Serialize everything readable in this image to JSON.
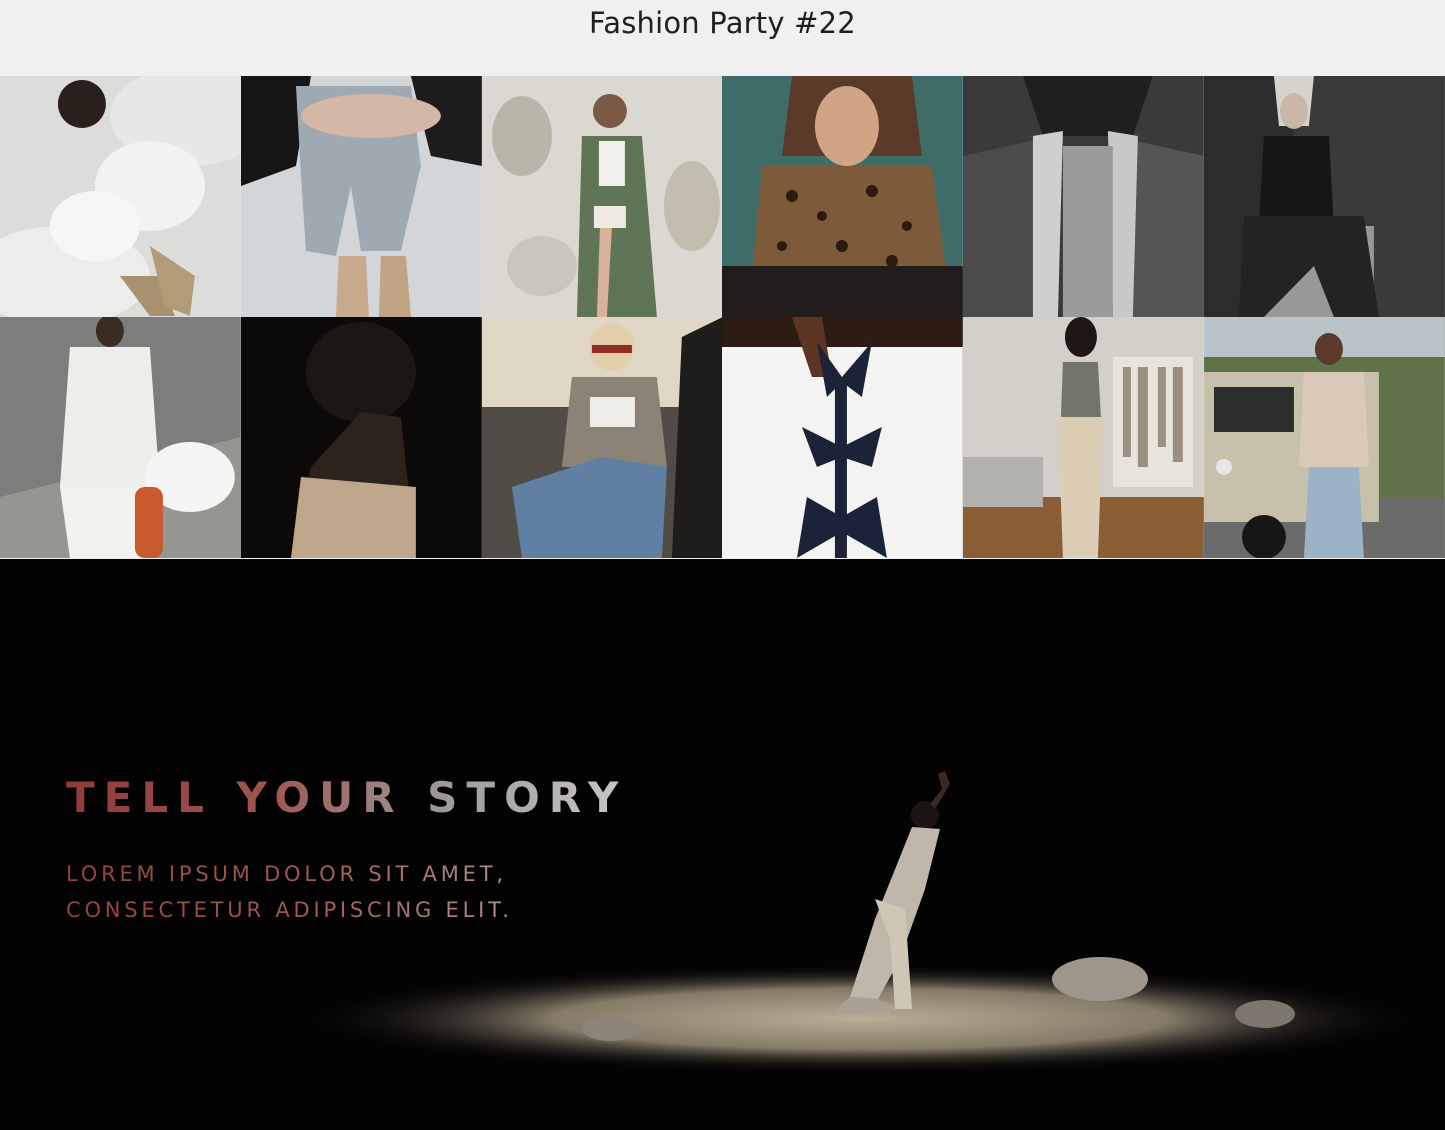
{
  "header": {
    "title": "Fashion Party #22"
  },
  "gallery": {
    "photos": [
      {
        "name": "photo-angel-wings-clouds",
        "bg": "#d9d9d7"
      },
      {
        "name": "photo-jeans-snakeskin-boots",
        "bg": "#cfd3d5"
      },
      {
        "name": "photo-green-cardigan-wall",
        "bg": "#d8d6cf"
      },
      {
        "name": "photo-leopard-coat",
        "bg": "#3f6e6a"
      },
      {
        "name": "photo-shearling-jacket",
        "bg": "#4a4a4a"
      },
      {
        "name": "photo-seated-bw-portrait",
        "bg": "#2b2b2b"
      },
      {
        "name": "photo-white-outfit-skateboard",
        "bg": "#8c8c8a"
      },
      {
        "name": "photo-dark-portrait-profile",
        "bg": "#0e0b0a"
      },
      {
        "name": "photo-convertible-car",
        "bg": "#6f6a63"
      },
      {
        "name": "photo-ribbon-bows-back",
        "bg": "#f4f4f4"
      },
      {
        "name": "photo-living-room-outfit",
        "bg": "#cfc9c0"
      },
      {
        "name": "photo-jeep-street",
        "bg": "#7d8a6f"
      }
    ]
  },
  "hero": {
    "title": "TELL YOUR STORY",
    "subtitle_line1": "LOREM IPSUM DOLOR SIT AMET,",
    "subtitle_line2": "CONSECTETUR ADIPISCING ELIT."
  }
}
